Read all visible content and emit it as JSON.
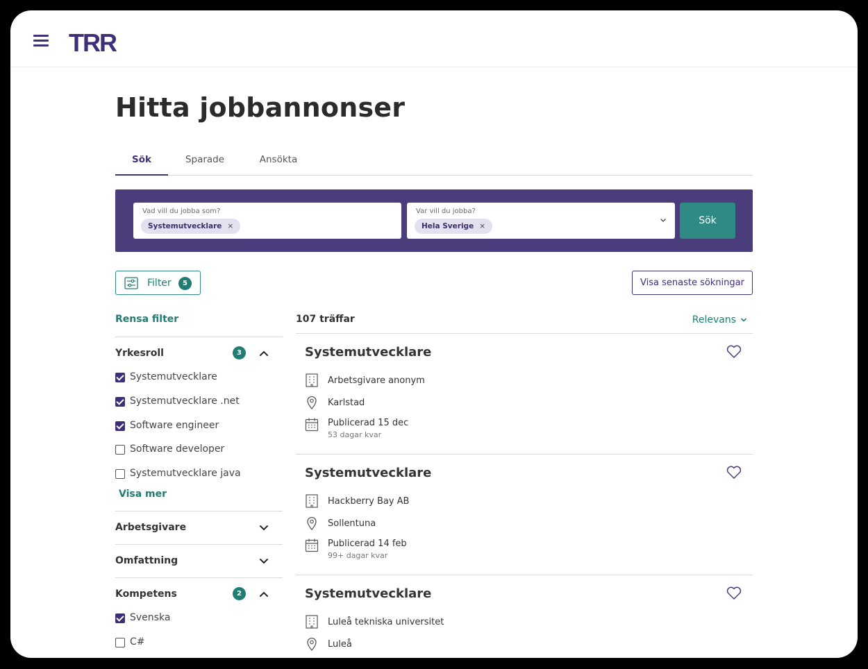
{
  "header": {
    "logo_text": "TRR"
  },
  "page": {
    "title": "Hitta jobbannonser"
  },
  "tabs": [
    {
      "label": "Sök",
      "active": true
    },
    {
      "label": "Sparade",
      "active": false
    },
    {
      "label": "Ansökta",
      "active": false
    }
  ],
  "search": {
    "what_label": "Vad vill du jobba som?",
    "what_chip": "Systemutvecklare",
    "where_label": "Var vill du jobba?",
    "where_chip": "Hela Sverige",
    "chip_remove": "×",
    "button_label": "Sök"
  },
  "toolbar": {
    "filter_label": "Filter",
    "filter_count": "5",
    "recent_label": "Visa senaste sökningar"
  },
  "sidebar": {
    "clear_label": "Rensa filter",
    "sections": [
      {
        "title": "Yrkesroll",
        "count": "3",
        "expanded": true,
        "options": [
          {
            "label": "Systemutvecklare",
            "checked": true
          },
          {
            "label": "Systemutvecklare .net",
            "checked": true
          },
          {
            "label": "Software engineer",
            "checked": true
          },
          {
            "label": "Software developer",
            "checked": false
          },
          {
            "label": "Systemutvecklare java",
            "checked": false
          }
        ],
        "more_label": "Visa mer"
      },
      {
        "title": "Arbetsgivare",
        "expanded": false
      },
      {
        "title": "Omfattning",
        "expanded": false
      },
      {
        "title": "Kompetens",
        "count": "2",
        "expanded": true,
        "options": [
          {
            "label": "Svenska",
            "checked": true
          },
          {
            "label": "C#",
            "checked": false
          }
        ]
      }
    ]
  },
  "results": {
    "count_label": "107 träffar",
    "sort_label": "Relevans",
    "jobs": [
      {
        "title": "Systemutvecklare",
        "employer": "Arbetsgivare anonym",
        "location": "Karlstad",
        "published": "Publicerad 15 dec",
        "remaining": "53 dagar kvar"
      },
      {
        "title": "Systemutvecklare",
        "employer": "Hackberry Bay AB",
        "location": "Sollentuna",
        "published": "Publicerad 14 feb",
        "remaining": "99+ dagar kvar"
      },
      {
        "title": "Systemutvecklare",
        "employer": "Luleå tekniska universitet",
        "location": "Luleå",
        "published": "",
        "remaining": ""
      }
    ]
  },
  "colors": {
    "brand_purple": "#3d2f78",
    "panel_purple": "#4b3d7c",
    "teal": "#1f7d73",
    "search_button": "#2f8a83"
  },
  "icons": {
    "menu": "hamburger-icon",
    "filter": "sliders-icon",
    "employer": "building-icon",
    "location": "map-pin-icon",
    "date": "calendar-icon",
    "favorite": "heart-icon"
  }
}
